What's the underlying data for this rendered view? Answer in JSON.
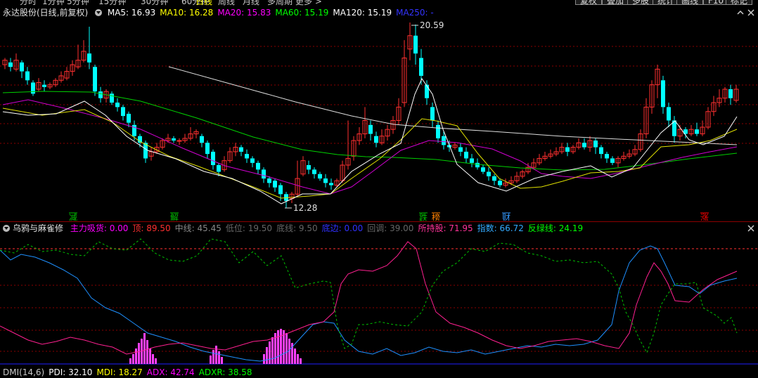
{
  "toolbar": {
    "periods": [
      "分时",
      "1分钟",
      "5分钟",
      "15分钟",
      "30分钟",
      "60分钟",
      "日线",
      "周线",
      "月线",
      "多周期",
      "更多 >"
    ],
    "active_period": "日线",
    "buttons": [
      "复权",
      "叠加",
      "多股",
      "统计",
      "画线",
      "F10",
      "标记"
    ]
  },
  "main_chart": {
    "title": "永达股份(日线,前复权)",
    "ma": [
      {
        "label": "MA5: 16.93",
        "color": "#ffffff"
      },
      {
        "label": "MA10: 16.28",
        "color": "#ffff00"
      },
      {
        "label": "MA20: 15.83",
        "color": "#ff00ff"
      },
      {
        "label": "MA60: 15.19",
        "color": "#00ff00"
      },
      {
        "label": "MA120: 15.19",
        "color": "#ffffff"
      },
      {
        "label": "MA250: -",
        "color": "#3333ff"
      }
    ],
    "high_label": "20.59",
    "low_label": "12.28",
    "markers": [
      {
        "text": "减",
        "color": "#00c000"
      },
      {
        "text": "解",
        "color": "#00c000"
      },
      {
        "text": "跌",
        "color": "#00c000"
      },
      {
        "text": "榜",
        "color": "#ff8000"
      },
      {
        "text": "财",
        "color": "#3399ff"
      },
      {
        "text": "涨",
        "color": "#ff0000"
      }
    ]
  },
  "indicator": {
    "title": "乌鸦与麻雀修",
    "values": [
      {
        "label": "主力吸货: 0.00",
        "color": "#ff00ff"
      },
      {
        "label": "顶: 89.50",
        "color": "#ff3030"
      },
      {
        "label": "中线: 45.45",
        "color": "#888888"
      },
      {
        "label": "低位: 19.50",
        "color": "#666666"
      },
      {
        "label": "底线: 9.50",
        "color": "#666666"
      },
      {
        "label": "底边: 0.00",
        "color": "#3030ff"
      },
      {
        "label": "回调: 39.00",
        "color": "#666666"
      },
      {
        "label": "所持股: 71.95",
        "color": "#ff3399"
      },
      {
        "label": "指数: 66.72",
        "color": "#33aaff"
      },
      {
        "label": "反绿线: 24.19",
        "color": "#00ff00"
      }
    ]
  },
  "dmi": {
    "values": [
      {
        "label": "DMI(14,6)",
        "color": "#c8c8c8"
      },
      {
        "label": "PDI: 32.10",
        "color": "#ffffff"
      },
      {
        "label": "MDI: 18.27",
        "color": "#ffff00"
      },
      {
        "label": "ADX: 42.74",
        "color": "#ff00ff"
      },
      {
        "label": "ADXR: 38.58",
        "color": "#00ff00"
      }
    ]
  },
  "colors": {
    "up": "#ff3030",
    "down": "#00ffff",
    "grid": "#8b0000",
    "bg": "#000000"
  },
  "chart_data": {
    "type": "candlestick",
    "price_range": [
      12.28,
      20.59
    ],
    "annotated_high": 20.59,
    "annotated_low": 12.28,
    "ma_latest": {
      "MA5": 16.93,
      "MA10": 16.28,
      "MA20": 15.83,
      "MA60": 15.19,
      "MA120": 15.19,
      "MA250": null
    },
    "indicator_latest": {
      "主力吸货": 0.0,
      "顶": 89.5,
      "中线": 45.45,
      "低位": 19.5,
      "底线": 9.5,
      "底边": 0.0,
      "回调": 39.0,
      "所持股": 71.95,
      "指数": 66.72,
      "反绿线": 24.19
    },
    "dmi_latest": {
      "PDI": 32.1,
      "MDI": 18.27,
      "ADX": 42.74,
      "ADXR": 38.58
    }
  }
}
